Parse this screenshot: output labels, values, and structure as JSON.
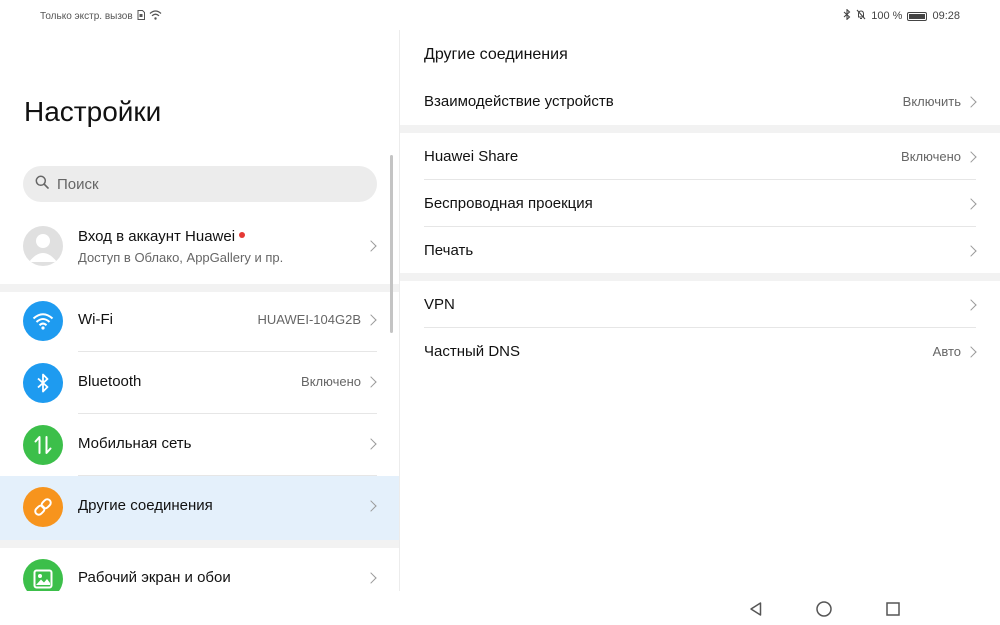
{
  "status_bar": {
    "left_text": "Только экстр. вызов",
    "battery_text": "100 %",
    "battery_level": 1.0,
    "time": "09:28"
  },
  "left": {
    "title": "Настройки",
    "search": {
      "placeholder": "Поиск",
      "icon": "search-icon"
    },
    "account": {
      "title": "Вход в аккаунт Huawei",
      "subtitle": "Доступ в Облако, AppGallery и пр.",
      "dot_color": "#e53935"
    },
    "items": [
      {
        "label": "Wi‑Fi",
        "value": "HUAWEI-104G2B",
        "icon": "wifi-icon",
        "color": "#1e9bf0"
      },
      {
        "label": "Bluetooth",
        "value": "Включено",
        "icon": "bluetooth-icon",
        "color": "#1e9bf0"
      },
      {
        "label": "Мобильная сеть",
        "value": "",
        "icon": "mobile-data-icon",
        "color": "#3cbf4a"
      },
      {
        "label": "Другие соединения",
        "value": "",
        "icon": "link-icon",
        "color": "#f7941d",
        "active": true
      },
      {
        "label": "Рабочий экран и обои",
        "value": "",
        "icon": "wallpaper-icon",
        "color": "#3cbf4a"
      }
    ]
  },
  "right": {
    "title": "Другие соединения",
    "rows": [
      {
        "label": "Взаимодействие устройств",
        "value": "Включить"
      },
      {
        "label": "Huawei Share",
        "value": "Включено"
      },
      {
        "label": "Беспроводная проекция",
        "value": ""
      },
      {
        "label": "Печать",
        "value": ""
      },
      {
        "label": "VPN",
        "value": ""
      },
      {
        "label": "Частный DNS",
        "value": "Авто"
      }
    ]
  },
  "colors": {
    "active_bg": "#e4f0fb",
    "band": "#f2f2f2"
  }
}
